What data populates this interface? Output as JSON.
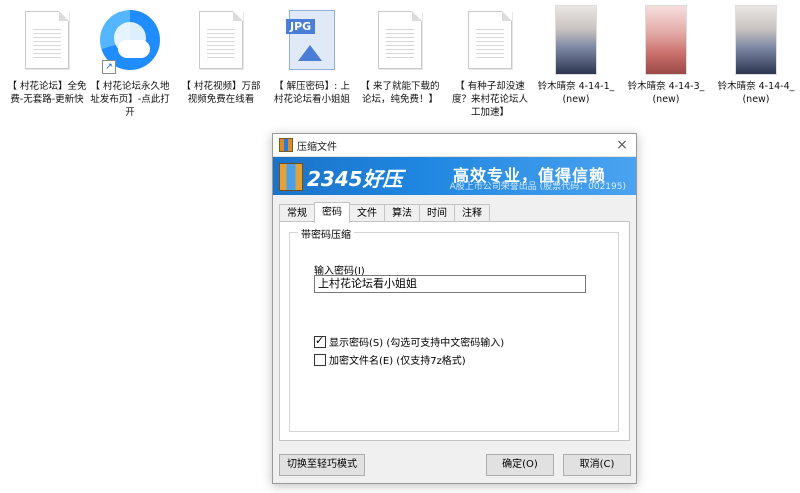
{
  "desktop": {
    "items": [
      {
        "label": "【 村花论坛】全免费-无套路-更新快",
        "icon": "text-document-icon"
      },
      {
        "label": "【 村花论坛永久地址发布页】-点此打开",
        "icon": "browser-shortcut-icon"
      },
      {
        "label": "【 村花视频】万部视频免费在线看",
        "icon": "text-document-icon"
      },
      {
        "label": "【 解压密码】: 上村花论坛看小姐姐",
        "icon": "jpg-file-icon",
        "tag": "JPG"
      },
      {
        "label": "【 来了就能下载的论坛，纯免费！】",
        "icon": "text-document-icon"
      },
      {
        "label": "【 有种子却没速度？来村花论坛人工加速】",
        "icon": "text-document-icon"
      },
      {
        "label": "铃木晴奈 4-14-1_(new)",
        "icon": "photo-thumbnail-icon"
      },
      {
        "label": "铃木晴奈 4-14-3_(new)",
        "icon": "photo-thumbnail-icon"
      },
      {
        "label": "铃木晴奈 4-14-4_(new)",
        "icon": "photo-thumbnail-icon"
      }
    ]
  },
  "dialog": {
    "title": "压缩文件",
    "close": "×",
    "banner": {
      "brand": "2345好压",
      "slogan": "高效专业，值得信赖",
      "sub": "A股上市公司荣誉出品 (股票代码：002195)"
    },
    "tabs": [
      {
        "label": "常规",
        "active": false
      },
      {
        "label": "密码",
        "active": true
      },
      {
        "label": "文件",
        "active": false
      },
      {
        "label": "算法",
        "active": false
      },
      {
        "label": "时间",
        "active": false
      },
      {
        "label": "注释",
        "active": false
      }
    ],
    "group_title": "带密码压缩",
    "password_label": "输入密码(I)",
    "password_value": "上村花论坛看小姐姐",
    "show_password": {
      "label": "显示密码(S)  (勾选可支持中文密码输入)",
      "checked": true
    },
    "encrypt_names": {
      "label": "加密文件名(E)  (仅支持7z格式)",
      "checked": false
    },
    "buttons": {
      "switch_mode": "切换至轻巧模式",
      "ok": "确定(O)",
      "cancel": "取消(C)"
    }
  }
}
